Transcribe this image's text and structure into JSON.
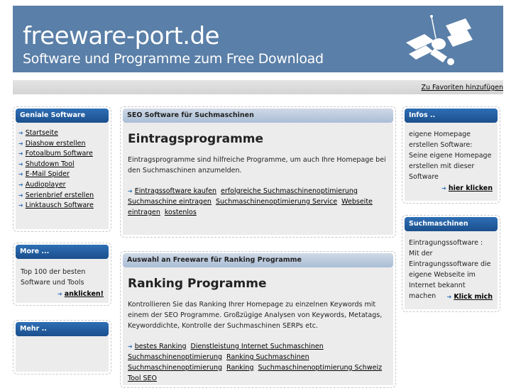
{
  "header": {
    "title": "freeware-port.de",
    "subtitle": "Software und Programme zum Free Download"
  },
  "topbar": {
    "favorites_link": "Zu Favoriten hinzufügen"
  },
  "left": {
    "software_box": {
      "title": "Geniale Software",
      "items": [
        "Startseite",
        "Diashow erstellen",
        "Fotoalbum Software",
        "Shutdown Tool",
        "E-Mail Spider",
        "Audioplayer",
        "Serienbrief erstellen",
        "Linktausch Software"
      ]
    },
    "more_box": {
      "title": "More ...",
      "text": "Top 100 der besten Software und Tools",
      "link": "anklicken!"
    },
    "mehr_box": {
      "title": "Mehr .."
    }
  },
  "main": {
    "box1": {
      "bar_title": "SEO Software für Suchmaschinen",
      "heading": "Eintragsprogramme",
      "description": "Eintragsprogramme sind hilfreiche Programme, um auch Ihre Homepage bei den Suchmaschinen anzumelden.",
      "links": [
        "Eintragssoftware kaufen",
        "erfolgreiche Suchmaschinenoptimierung",
        "Suchmaschine eintragen",
        "Suchmaschinenoptimierung Service",
        "Webseite eintragen",
        "kostenlos"
      ]
    },
    "box2": {
      "bar_title": "Auswahl an Freeware für Ranking Programme",
      "heading": "Ranking Programme",
      "description": "Kontrollieren Sie das Ranking Ihrer Homepage zu einzelnen Keywords mit einem der SEO Programme. Großzügige Analysen von Keywords, Metatags, Keyworddichte, Kontrolle der Suchmaschinen SERPs etc.",
      "links": [
        "bestes Ranking",
        "Dienstleistung Internet Suchmaschinen",
        "Suchmaschinenoptimierung",
        "Ranking Suchmaschinen",
        "Suchmaschinenoptimierung",
        "Ranking",
        "Suchmaschinenoptimierung Schweiz",
        "Tool SEO"
      ]
    }
  },
  "right": {
    "infos_box": {
      "title": "Infos ..",
      "text": "eigene Homepage erstellen Software: Seine eigene Homepage erstellen mit dieser Software",
      "link": "hier klicken"
    },
    "search_box": {
      "title": "Suchmaschinen",
      "text": "Eintragungssoftware : Mit der Eintragungssoftware die eigene Webseite im Internet bekannt machen",
      "link": "Klick mich"
    }
  },
  "colors": {
    "header_bg": "#5a7fa8",
    "box_bar": "#1b4f8c",
    "main_bar": "#aabed6",
    "arrow": "#2f6fb5"
  },
  "icons": [
    "satellite-logo-icon",
    "arrow-right-icon"
  ]
}
